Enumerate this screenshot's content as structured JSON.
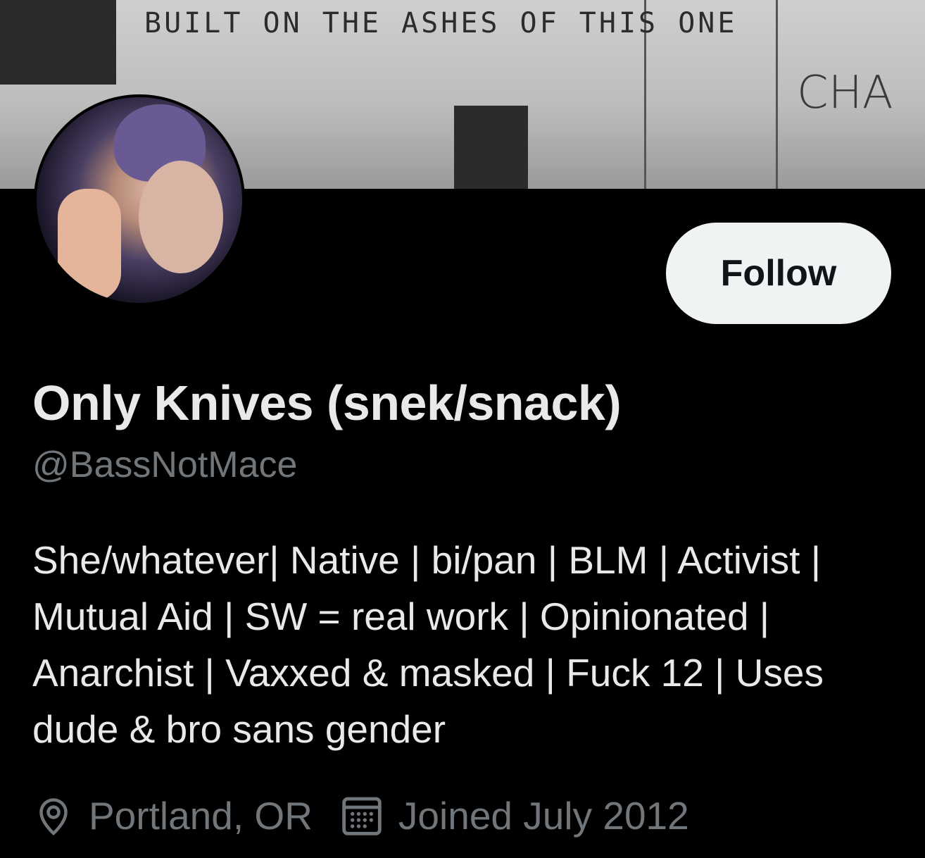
{
  "banner": {
    "graffiti_text": "BUILT ON THE ASHES OF THIS ONE",
    "corner_text": "CHA"
  },
  "profile": {
    "display_name": "Only Knives (snek/snack)",
    "handle": "@BassNotMace",
    "bio": "She/whatever| Native | bi/pan | BLM | Activist | Mutual Aid | SW = real work | Opinionated | Anarchist | Vaxxed & masked | Fuck 12 | Uses dude & bro sans gender",
    "location": "Portland, OR",
    "joined": "Joined July 2012"
  },
  "actions": {
    "follow_label": "Follow"
  },
  "icons": {
    "location": "location-pin-icon",
    "joined": "calendar-icon"
  },
  "colors": {
    "background": "#000000",
    "text_primary": "#e7e9ea",
    "text_secondary": "#71767b",
    "follow_bg": "#eff3f4",
    "follow_text": "#0f1419"
  }
}
